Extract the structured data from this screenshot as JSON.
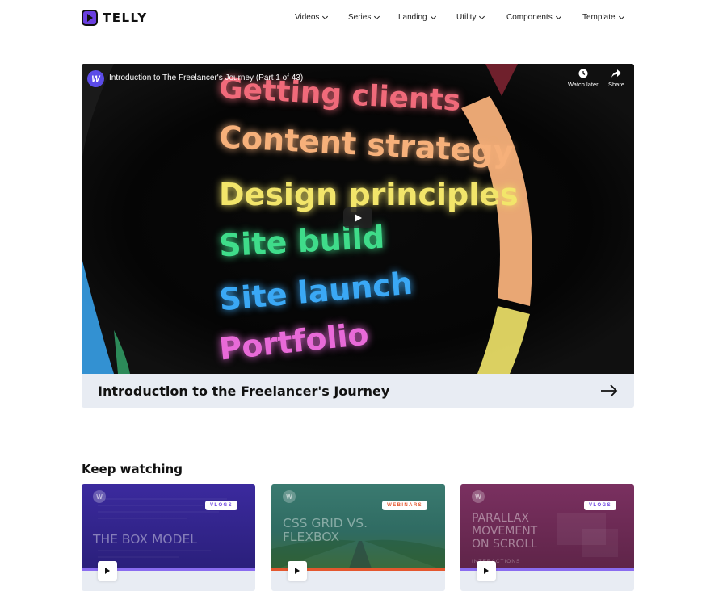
{
  "brand": {
    "name": "TELLY",
    "accent": "#6a3fe0"
  },
  "nav": {
    "items": [
      {
        "label": "Videos"
      },
      {
        "label": "Series"
      },
      {
        "label": "Landing"
      },
      {
        "label": "Utility"
      },
      {
        "label": "Components"
      },
      {
        "label": "Template"
      }
    ]
  },
  "hero": {
    "channel_initial": "W",
    "video_title": "Introduction to The Freelancer's Journey (Part 1 of 43)",
    "watch_later_label": "Watch later",
    "share_label": "Share",
    "words": [
      {
        "text": "Getting clients",
        "color": "#f06a7a"
      },
      {
        "text": "Content strategy",
        "color": "#f6b07a"
      },
      {
        "text": "Design principles",
        "color": "#f2e56a"
      },
      {
        "text": "Site build",
        "color": "#3fdc8a"
      },
      {
        "text": "Site launch",
        "color": "#3aa8f5"
      },
      {
        "text": "Portfolio",
        "color": "#e86ad8"
      }
    ],
    "caption": "Introduction to the Freelancer's Journey"
  },
  "keep_watching": {
    "title": "Keep watching",
    "cards": [
      {
        "initial": "W",
        "badge": "VLOGS",
        "badge_color": "#6a3fe0",
        "title_lines": [
          "THE BOX MODEL"
        ],
        "sub": "",
        "bg": "#3b2a9e",
        "stripe": "#8a6cf0"
      },
      {
        "initial": "W",
        "badge": "WEBINARS",
        "badge_color": "#e4572e",
        "title_lines": [
          "CSS GRID VS.",
          "FLEXBOX"
        ],
        "sub": "",
        "bg": "#2f6b62",
        "stripe": "#e4572e"
      },
      {
        "initial": "W",
        "badge": "VLOGS",
        "badge_color": "#6a3fe0",
        "title_lines": [
          "PARALLAX",
          "MOVEMENT",
          "ON SCROLL"
        ],
        "sub": "INTERACTIONS",
        "bg": "#6b2a52",
        "stripe": "#8a6cf0"
      }
    ]
  }
}
